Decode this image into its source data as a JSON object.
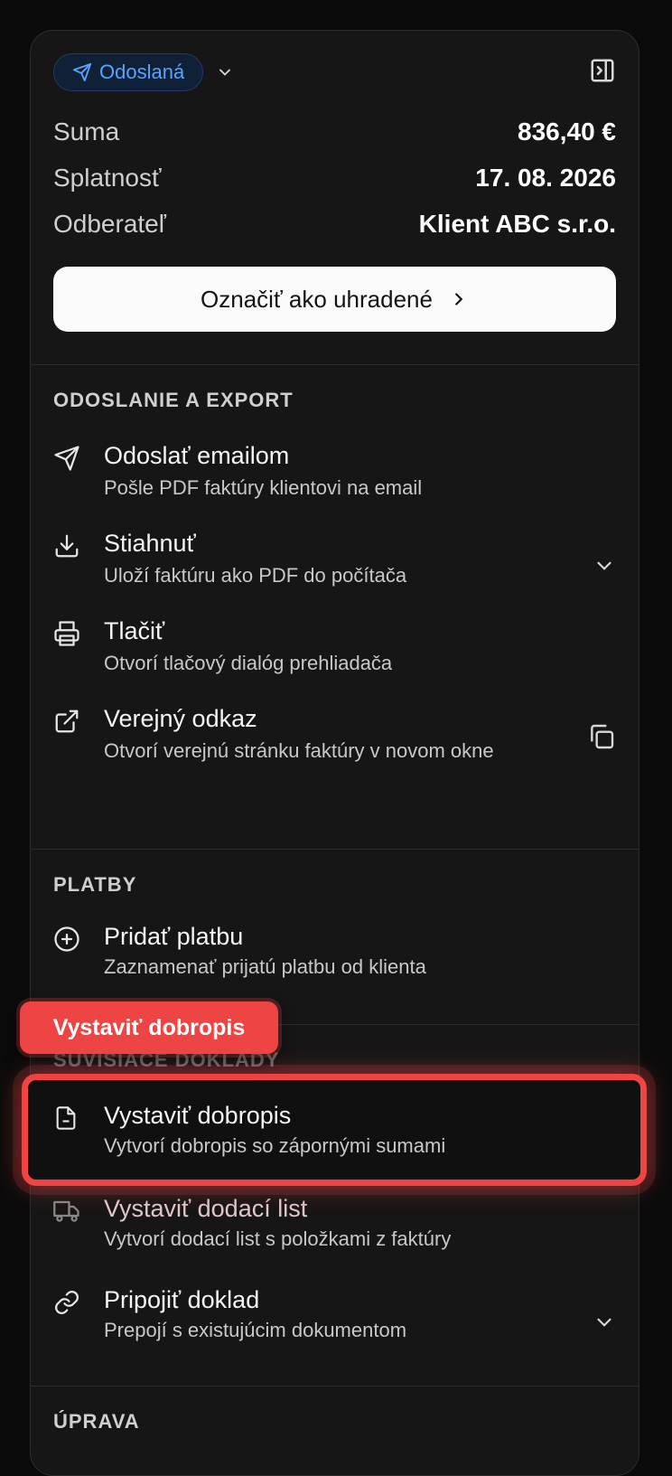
{
  "header": {
    "status_label": "Odoslaná"
  },
  "summary": [
    {
      "key": "Suma",
      "value": "836,40 €"
    },
    {
      "key": "Splatnosť",
      "value": "17. 08. 2026"
    },
    {
      "key": "Odberateľ",
      "value": "Klient ABC s.r.o."
    }
  ],
  "primary_action": "Označiť ako uhradené",
  "sections": {
    "export": {
      "title": "ODOSLANIE A EXPORT",
      "items": [
        {
          "title": "Odoslať emailom",
          "subtitle": "Pošle PDF faktúry klientovi na email",
          "icon": "send-icon"
        },
        {
          "title": "Stiahnuť",
          "subtitle": "Uloží faktúru ako PDF do počítača",
          "icon": "download-icon"
        },
        {
          "title": "Tlačiť",
          "subtitle": "Otvorí tlačový dialóg prehliadača",
          "icon": "printer-icon"
        },
        {
          "title": "Verejný odkaz",
          "subtitle": "Otvorí verejnú stránku faktúry v novom okne",
          "icon": "external-link-icon"
        }
      ]
    },
    "payments": {
      "title": "PLATBY",
      "items": [
        {
          "title": "Pridať platbu",
          "subtitle": "Zaznamenať prijatú platbu od klienta",
          "icon": "plus-circle-icon"
        }
      ]
    },
    "related": {
      "title": "SÚVISIACE DOKLADY",
      "items": [
        {
          "title": "Vystaviť dobropis",
          "subtitle": "Vytvorí dobropis so zápornými sumami",
          "icon": "file-minus-icon"
        },
        {
          "title": "Vystaviť dodací list",
          "subtitle": "Vytvorí dodací list s položkami z faktúry",
          "icon": "truck-icon"
        },
        {
          "title": "Pripojiť doklad",
          "subtitle": "Prepojí s existujúcim dokumentom",
          "icon": "link-icon"
        }
      ]
    },
    "next_title": "ÚPRAVA"
  },
  "callout": {
    "label": "Vystaviť dobropis",
    "color": "#ef4444"
  }
}
